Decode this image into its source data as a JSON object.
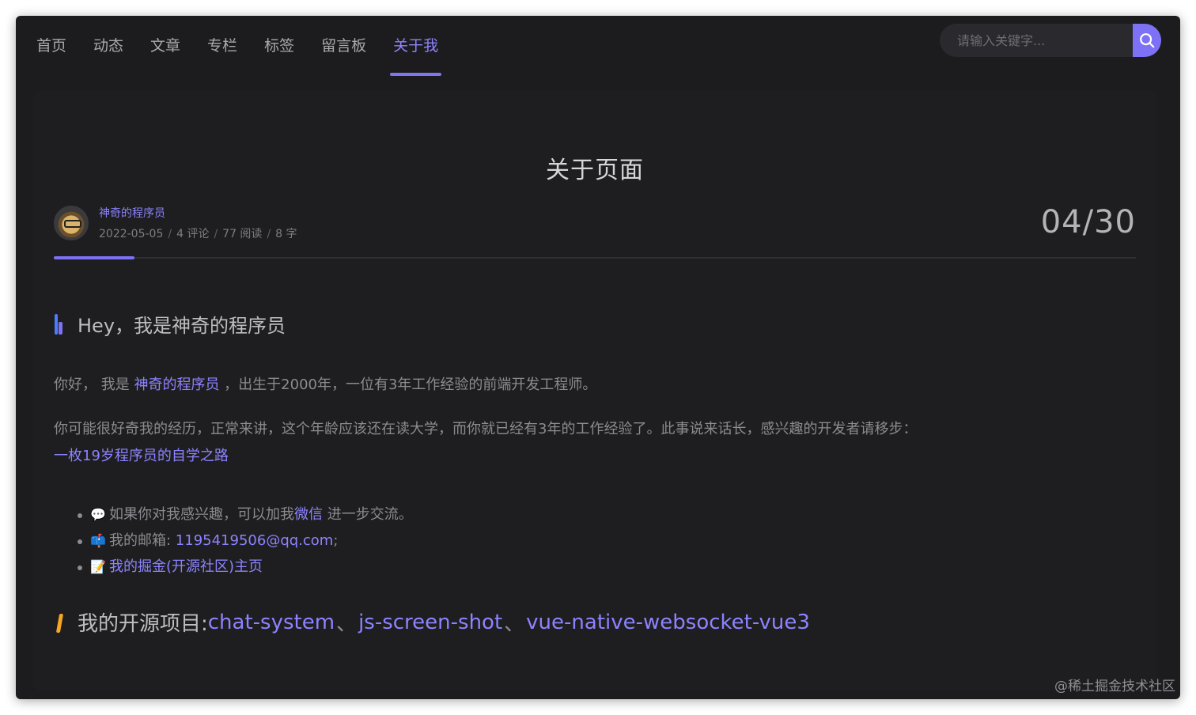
{
  "nav": {
    "items": [
      {
        "label": "首页",
        "active": false
      },
      {
        "label": "动态",
        "active": false
      },
      {
        "label": "文章",
        "active": false
      },
      {
        "label": "专栏",
        "active": false
      },
      {
        "label": "标签",
        "active": false
      },
      {
        "label": "留言板",
        "active": false
      },
      {
        "label": "关于我",
        "active": true
      }
    ]
  },
  "search": {
    "placeholder": "请输入关键字...",
    "icon": "search-icon"
  },
  "page": {
    "title": "关于页面",
    "author": "神奇的程序员",
    "date": "2022-05-05",
    "comments": "4 评论",
    "views": "77 阅读",
    "words": "8 字",
    "date_big": "04/30"
  },
  "section1": {
    "heading": "Hey，我是神奇的程序员",
    "p1_prefix": "你好， 我是 ",
    "p1_link": "神奇的程序员",
    "p1_suffix": " ，出生于2000年，一位有3年工作经验的前端开发工程师。",
    "p2_text": "你可能很好奇我的经历，正常来讲，这个年龄应该还在读大学，而你就已经有3年的工作经验了。此事说来话长，感兴趣的开发者请移步：",
    "p2_link": "一枚19岁程序员的自学之路"
  },
  "list": {
    "item1_emoji": "💬",
    "item1_prefix": "如果你对我感兴趣，可以加我",
    "item1_link": "微信",
    "item1_suffix": " 进一步交流。",
    "item2_emoji": "📫",
    "item2_prefix": "我的邮箱: ",
    "item2_link": "1195419506@qq.com",
    "item2_suffix": ";",
    "item3_emoji": "📝",
    "item3_link": "我的掘金(开源社区)主页"
  },
  "section2": {
    "heading_prefix": "我的开源项目: ",
    "link1": "chat-system",
    "sep": "、",
    "link2": "js-screen-shot",
    "link3": "vue-native-websocket-vue3"
  },
  "watermark": "@稀土掘金技术社区",
  "colors": {
    "accent": "#7d72f6",
    "link": "#8c83ff",
    "background": "#1c1c1e"
  }
}
